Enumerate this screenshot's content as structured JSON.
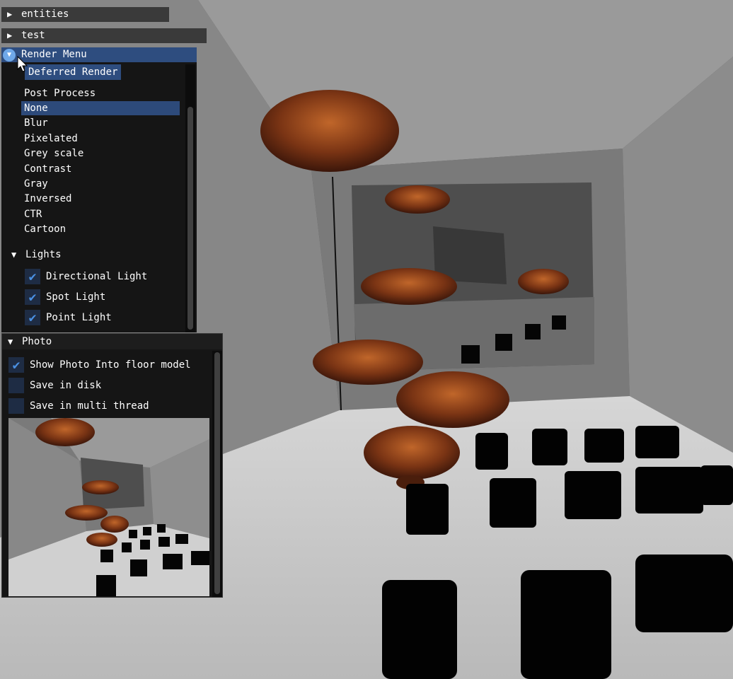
{
  "panels": {
    "entities_label": "entities",
    "test_label": "test",
    "render_menu": {
      "title": "Render Menu",
      "tab_label": "Deferred Render",
      "post_process_label": "Post Process",
      "post_process_options": [
        "None",
        "Blur",
        "Pixelated",
        "Grey scale",
        "Contrast",
        "Gray",
        "Inversed",
        "CTR",
        "Cartoon"
      ],
      "selected_option": "None",
      "lights": {
        "title": "Lights",
        "items": [
          {
            "label": "Directional Light",
            "checked": true
          },
          {
            "label": "Spot Light",
            "checked": true
          },
          {
            "label": "Point Light",
            "checked": true
          }
        ]
      }
    },
    "photo": {
      "title": "Photo",
      "options": [
        {
          "label": "Show Photo Into floor model",
          "checked": true
        },
        {
          "label": "Save in disk",
          "checked": false
        },
        {
          "label": "Save in multi thread",
          "checked": false
        }
      ]
    }
  },
  "colors": {
    "header_active": "#2e4d7f",
    "selection": "#2d4a7a",
    "checkmark": "#4a90e2",
    "panel_bg": "#151515"
  }
}
